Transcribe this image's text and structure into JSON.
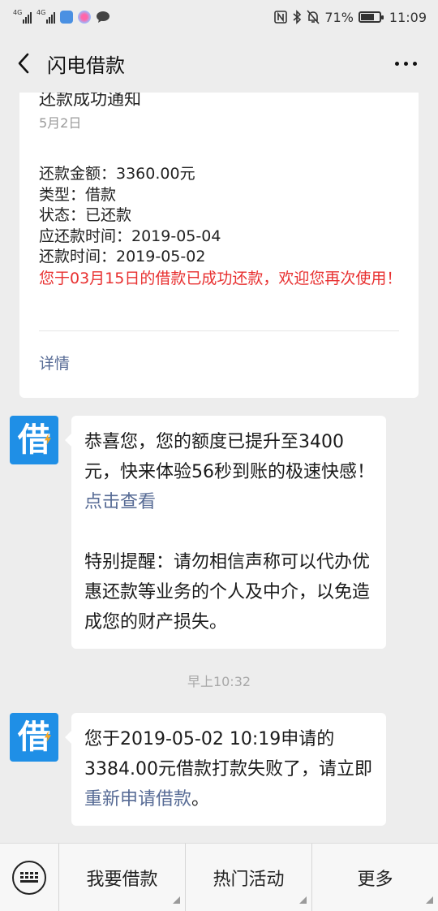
{
  "status_bar": {
    "signal1_label": "4G",
    "signal2_label": "4G",
    "battery_percent": "71%",
    "battery_level": 0.71,
    "time": "11:09",
    "icons": [
      "signal-icon",
      "signal-icon",
      "shield-app-icon",
      "camera-app-icon",
      "chat-bubble-icon",
      "nfc-icon",
      "bluetooth-icon",
      "mute-bell-icon",
      "battery-icon"
    ]
  },
  "header": {
    "title": "闪电借款",
    "back_icon": "chevron-left-icon",
    "more_icon": "more-dots-icon"
  },
  "card": {
    "title": "还款成功通知",
    "date": "5月2日",
    "lines": [
      "还款金额：3360.00元",
      "类型：借款",
      "状态：已还款",
      "应还款时间：2019-05-04",
      "还款时间：2019-05-02"
    ],
    "notice": "您于03月15日的借款已成功还款，欢迎您再次使用！",
    "link": "详情"
  },
  "messages": [
    {
      "avatar_text": "借",
      "para1_text": "恭喜您，您的额度已提升至3400元，快来体验56秒到账的极速快感！",
      "para1_link": "点击查看",
      "para2": "特别提醒：请勿相信声称可以代办优惠还款等业务的个人及中介，以免造成您的财产损失。"
    },
    {
      "avatar_text": "借",
      "text_before": "您于2019-05-02 10:19申请的3384.00元借款打款失败了，请立即",
      "link": "重新申请借款",
      "text_after": "。"
    }
  ],
  "timestamp": "早上10:32",
  "menu": {
    "keyboard_icon": "keyboard-icon",
    "items": [
      "我要借款",
      "热门活动",
      "更多"
    ]
  },
  "colors": {
    "background": "#ededed",
    "link": "#576b95",
    "notice_red": "#e83030",
    "avatar_blue": "#1f8fe6"
  }
}
